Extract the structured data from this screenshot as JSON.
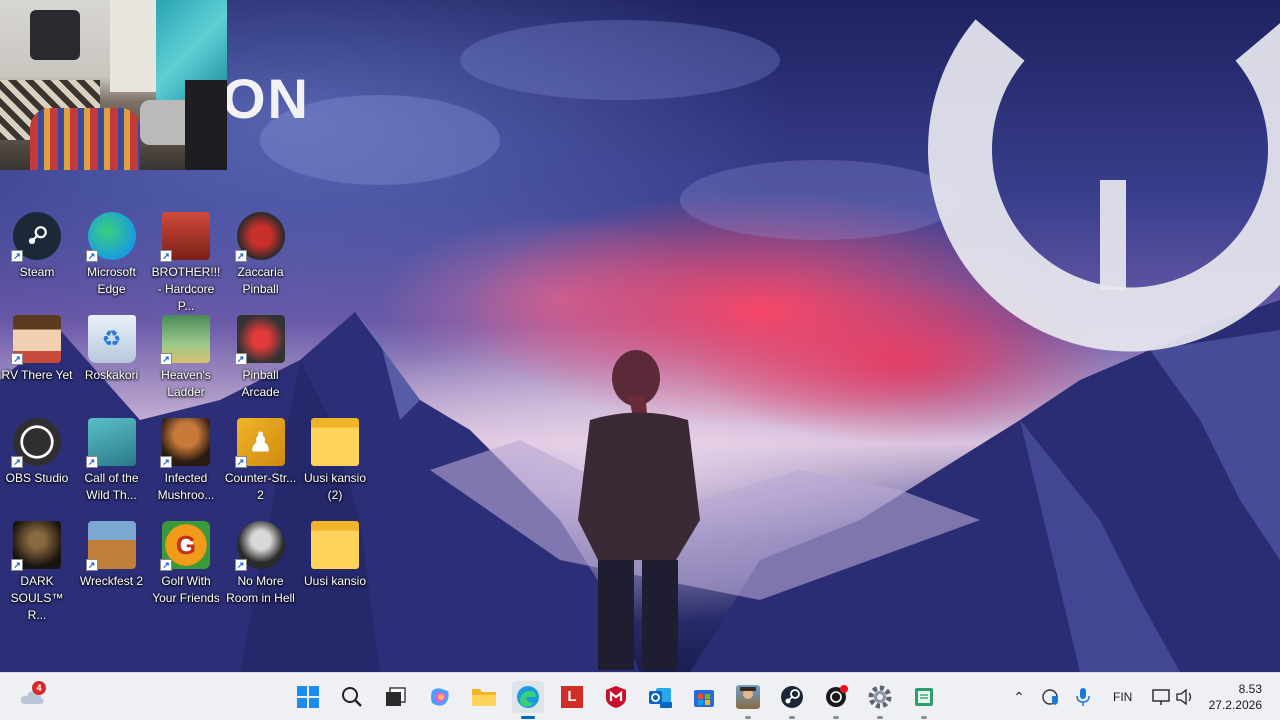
{
  "wallpaper": {
    "logo_text": "ON"
  },
  "desktop": {
    "icons": [
      {
        "label": "Steam",
        "icon": "steam-icon"
      },
      {
        "label": "Microsoft Edge",
        "icon": "edge-icon"
      },
      {
        "label": "BROTHER!!! - Hardcore P...",
        "icon": "brother-game-icon"
      },
      {
        "label": "Zaccaria Pinball",
        "icon": "zaccaria-pinball-icon"
      },
      {
        "label": "RV There Yet",
        "icon": "rv-there-yet-icon"
      },
      {
        "label": "Roskakori",
        "icon": "recycle-bin-icon"
      },
      {
        "label": "Heaven's Ladder",
        "icon": "heavens-ladder-icon"
      },
      {
        "label": "Pinball Arcade",
        "icon": "pinball-arcade-icon"
      },
      {
        "label": "OBS Studio",
        "icon": "obs-icon"
      },
      {
        "label": "Call of the Wild Th...",
        "icon": "call-of-the-wild-icon"
      },
      {
        "label": "Infected Mushroo...",
        "icon": "infected-mushroom-icon"
      },
      {
        "label": "Counter-Str... 2",
        "icon": "counter-strike-icon"
      },
      {
        "label": "Uusi kansio (2)",
        "icon": "folder-icon"
      },
      {
        "label": "DARK SOULS™ R...",
        "icon": "dark-souls-icon"
      },
      {
        "label": "Wreckfest 2",
        "icon": "wreckfest-icon"
      },
      {
        "label": "Golf With Your Friends",
        "icon": "golf-with-friends-icon"
      },
      {
        "label": "No More Room in Hell",
        "icon": "no-more-room-icon"
      },
      {
        "label": "Uusi kansio",
        "icon": "folder-icon"
      }
    ]
  },
  "taskbar": {
    "weather_badge": "4",
    "apps": [
      "start-icon",
      "search-icon",
      "task-view-icon",
      "copilot-icon",
      "file-explorer-icon",
      "edge-icon",
      "lastpass-icon",
      "mcafee-icon",
      "outlook-icon",
      "store-icon",
      "game-icon",
      "steam-icon",
      "chatgpt-icon",
      "settings-icon",
      "notepad-icon"
    ],
    "tray": {
      "language": "FIN",
      "time": "8.53",
      "date": "27.2.2026"
    }
  },
  "colors": {
    "taskbar_bg": "#eef0f4",
    "accent": "#0067c0",
    "badge": "#d42a2a"
  }
}
